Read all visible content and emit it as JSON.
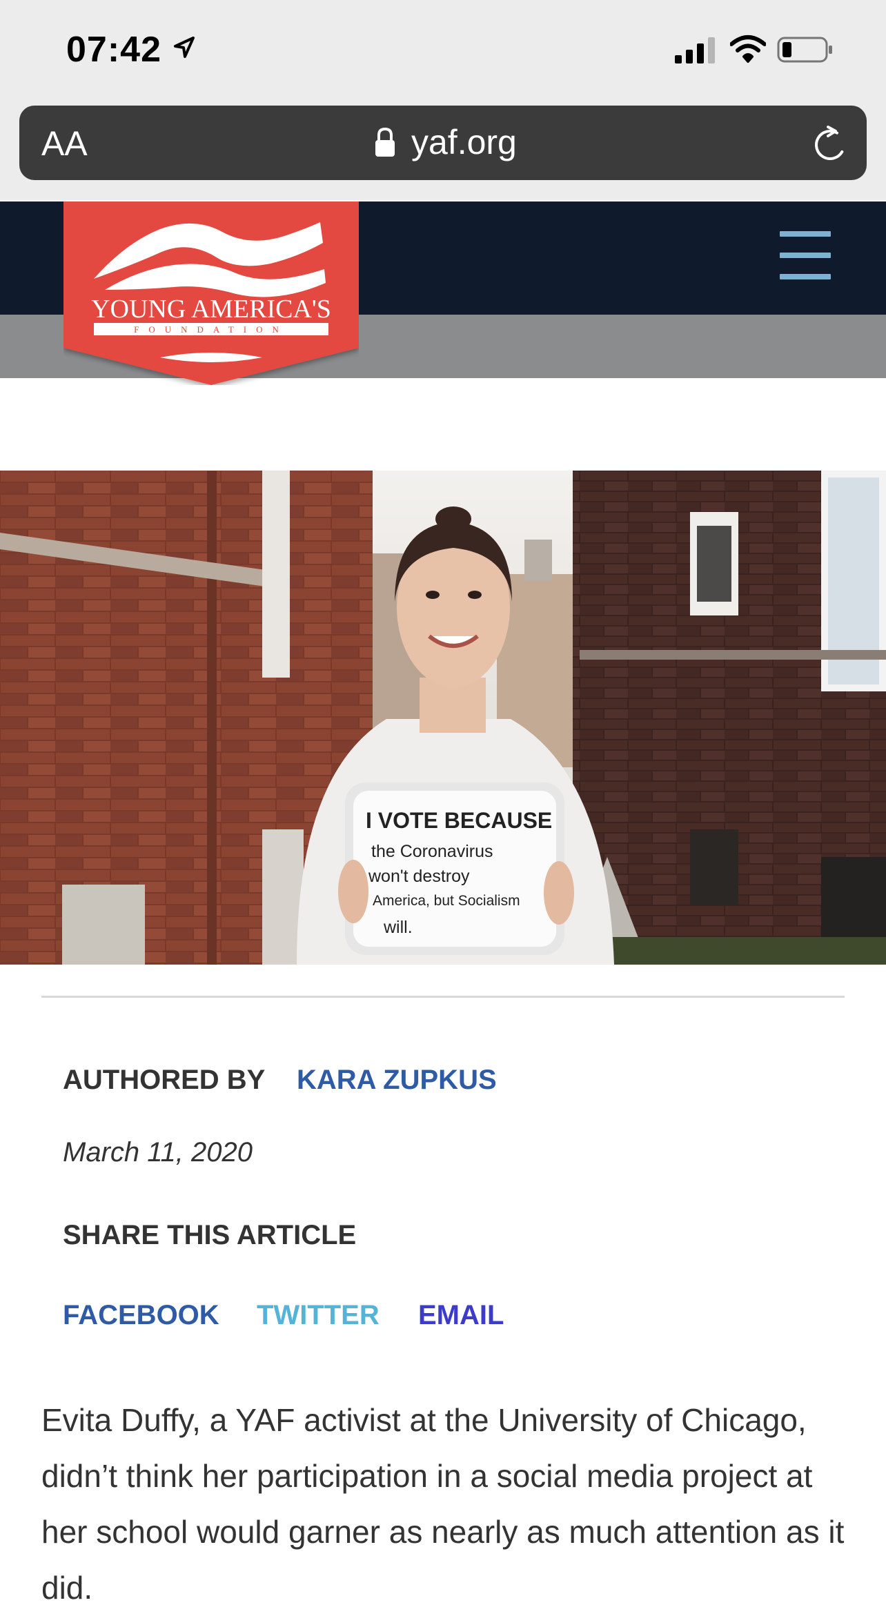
{
  "status_bar": {
    "time": "07:42",
    "icons": [
      "location-arrow-icon",
      "cellular-signal-icon",
      "wifi-icon",
      "battery-icon"
    ]
  },
  "browser": {
    "text_size_button": "AA",
    "url": "yaf.org",
    "icons": [
      "lock-icon",
      "reload-icon"
    ]
  },
  "site": {
    "logo_text": "YOUNG AMERICA'S",
    "logo_subtext": "FOUNDATION",
    "brand_color": "#e34a3f",
    "header_color": "#0f1b2d",
    "menu_icon": "hamburger-menu-icon"
  },
  "hero": {
    "sign_heading": "I VOTE BECAUSE",
    "sign_lines": [
      "the Coronavirus",
      "won't destroy",
      "America, but Socialism",
      "will."
    ]
  },
  "meta": {
    "authored_label": "AUTHORED BY",
    "author": "KARA ZUPKUS",
    "date": "March 11, 2020",
    "share_label": "SHARE THIS ARTICLE",
    "share_links": [
      "FACEBOOK",
      "TWITTER",
      "EMAIL"
    ]
  },
  "article": {
    "paragraph": "Evita Duffy, a YAF activist at the University of Chicago, didn’t think her participation in a social media project at her school would garner as nearly as much attention as it did."
  }
}
